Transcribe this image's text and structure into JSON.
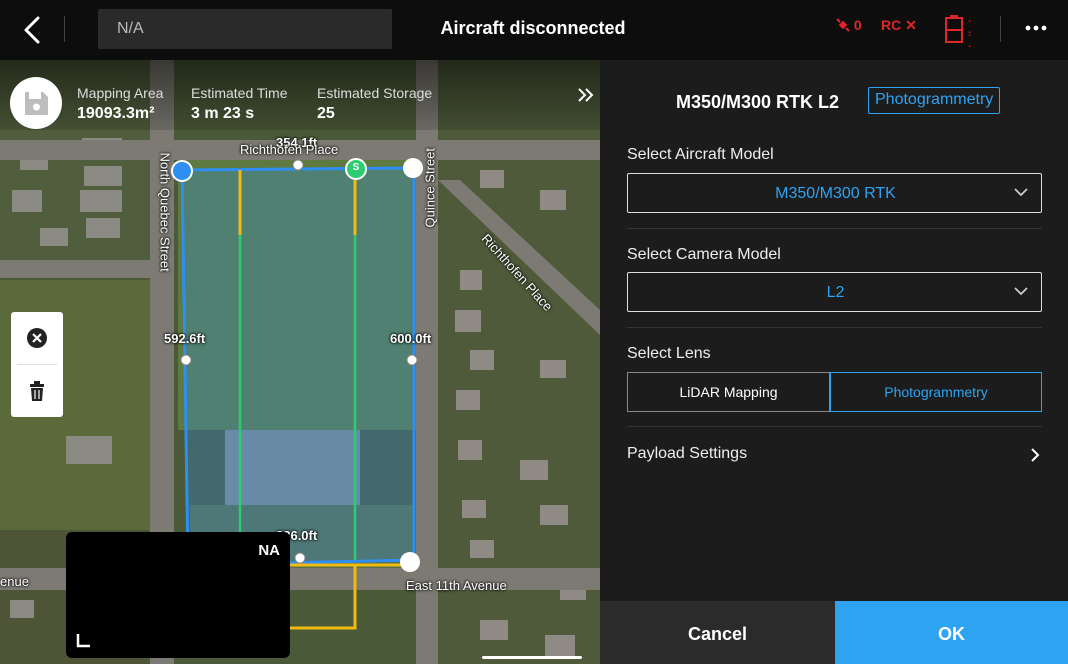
{
  "topbar": {
    "na_value": "N/A",
    "status_title": "Aircraft disconnected",
    "signal_count": "0",
    "rc_label": "RC",
    "rc_status": "✕",
    "battery_readout": "--"
  },
  "map": {
    "stats": [
      {
        "label": "Mapping Area",
        "value": "19093.3m²"
      },
      {
        "label": "Estimated Time",
        "value": "3 m 23 s"
      },
      {
        "label": "Estimated Storage",
        "value": "25"
      }
    ],
    "dimensions": {
      "top": "354.1ft",
      "left": "592.6ft",
      "right": "600.0ft",
      "bottom": "336.0ft"
    },
    "streets": {
      "north": "Richthofen Place",
      "west": "North Quebec Street",
      "east": "Quince Street",
      "diagonal": "Richthofen Place",
      "south": "East 11th Avenue",
      "southwest": "enue"
    },
    "start_marker": "S",
    "camera_view_label": "NA"
  },
  "panel": {
    "model_title": "M350/M300 RTK L2",
    "mode_badge": "Photogrammetry",
    "aircraft_label": "Select Aircraft Model",
    "aircraft_value": "M350/M300 RTK",
    "camera_label": "Select Camera Model",
    "camera_value": "L2",
    "lens_label": "Select Lens",
    "lens_options": [
      "LiDAR Mapping",
      "Photogrammetry"
    ],
    "lens_selected": "Photogrammetry",
    "payload_label": "Payload Settings",
    "cancel_label": "Cancel",
    "ok_label": "OK"
  },
  "colors": {
    "accent": "#2ea3f2",
    "alert": "#e0262a",
    "route_green": "#2ecc71",
    "route_yellow": "#f2b90f",
    "area_border": "#2e8ef2"
  }
}
